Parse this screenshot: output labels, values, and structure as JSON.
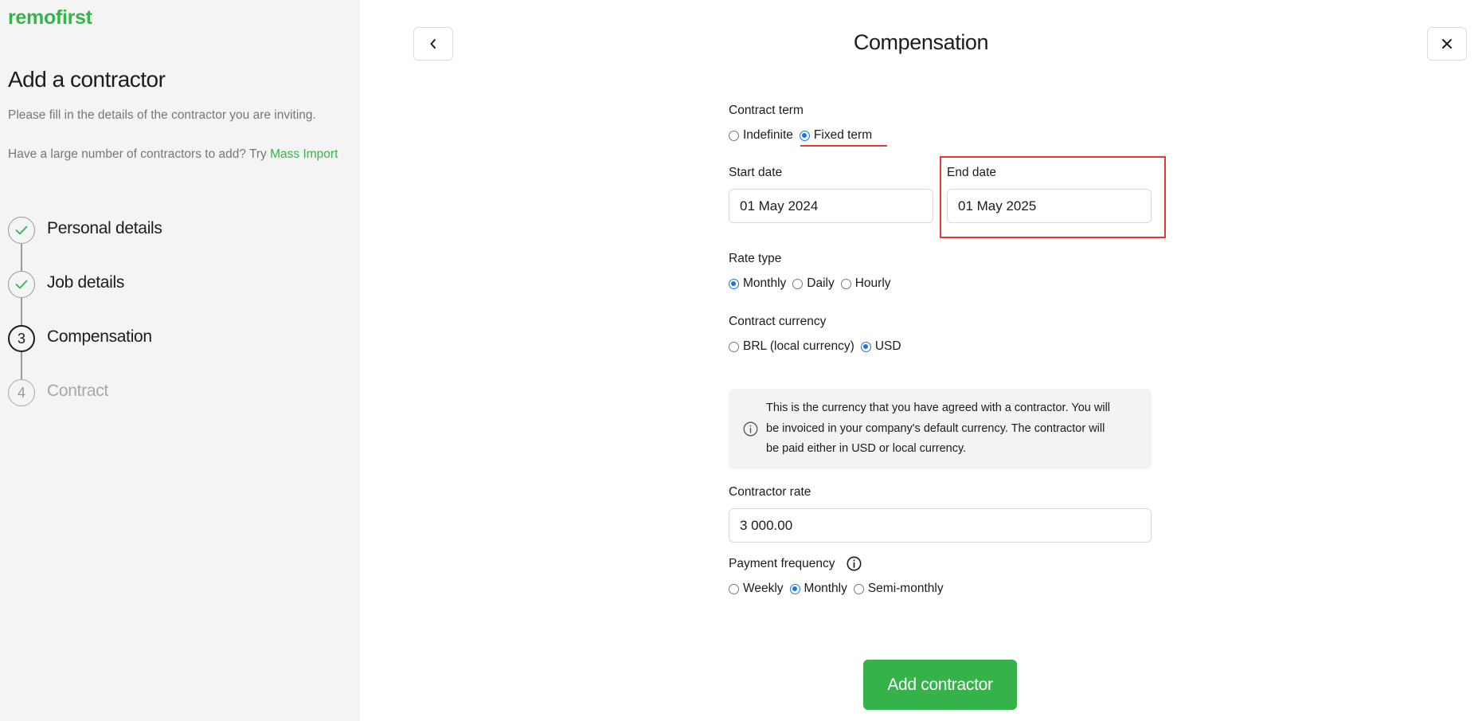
{
  "sidebar": {
    "logo": "remofirst",
    "title": "Add a contractor",
    "subtitle": "Please fill in the details of the contractor you are inviting.",
    "import_prompt": "Have a large number of contractors to add? Try ",
    "import_link": "Mass Import",
    "steps": [
      {
        "number": "",
        "label": "Personal details",
        "status": "completed"
      },
      {
        "number": "",
        "label": "Job details",
        "status": "completed"
      },
      {
        "number": "3",
        "label": "Compensation",
        "status": "current"
      },
      {
        "number": "4",
        "label": "Contract",
        "status": "upcoming"
      }
    ]
  },
  "header": {
    "title": "Compensation",
    "back_icon": "chevron-left-icon",
    "close_icon": "close-icon"
  },
  "form": {
    "contract_term": {
      "label": "Contract term",
      "options": [
        "Indefinite",
        "Fixed term"
      ],
      "selected": "Fixed term"
    },
    "start_date": {
      "label": "Start date",
      "value": "01 May 2024"
    },
    "end_date": {
      "label": "End date",
      "value": "01 May 2025"
    },
    "rate_type": {
      "label": "Rate type",
      "options": [
        "Monthly",
        "Daily",
        "Hourly"
      ],
      "selected": "Monthly"
    },
    "contract_currency": {
      "label": "Contract currency",
      "options": [
        "BRL (local currency)",
        "USD"
      ],
      "selected": "USD"
    },
    "info": {
      "line1": "This is the currency that you have agreed with a contractor. You will",
      "line2": "be invoiced in your company's default currency. The contractor will",
      "line3": "be paid either in USD or local currency."
    },
    "contractor_rate": {
      "label": "Contractor rate",
      "value": "3 000.00"
    },
    "payment_frequency": {
      "label": "Payment frequency",
      "options": [
        "Weekly",
        "Monthly",
        "Semi-monthly"
      ],
      "selected": "Monthly"
    },
    "submit_label": "Add contractor"
  },
  "colors": {
    "brand_green": "#32b64a",
    "radio_blue": "#1a73e8",
    "highlight_red": "#e53935"
  }
}
